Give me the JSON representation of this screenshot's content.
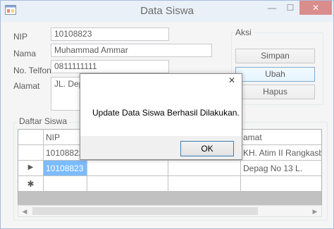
{
  "window": {
    "title": "Data Siswa",
    "minimize_glyph": "—",
    "maximize_glyph": "☐",
    "close_glyph": "✕"
  },
  "form": {
    "nip_label": "NIP",
    "nip_value": "10108823",
    "nama_label": "Nama",
    "nama_value": "Muhammad Ammar",
    "telfon_label": "No. Telfon",
    "telfon_value": "0811111111",
    "alamat_label": "Alamat",
    "alamat_value": "JL. Depa"
  },
  "aksi": {
    "group_title": "Aksi",
    "simpan_label": "Simpan",
    "ubah_label": "Ubah",
    "hapus_label": "Hapus"
  },
  "daftar": {
    "group_title": "Daftar Siswa",
    "columns": [
      "NIP",
      "",
      "",
      "amat"
    ],
    "rows": [
      {
        "indicator": "",
        "nip": "10108822",
        "alamat": "KH. Atim II Rangkasbitung"
      },
      {
        "indicator": "▶",
        "nip": "10108823",
        "alamat": "Depag No 13 L."
      },
      {
        "indicator": "✱",
        "nip": "",
        "alamat": ""
      }
    ],
    "scroll_left_glyph": "◀",
    "scroll_right_glyph": "▶"
  },
  "dialog": {
    "close_glyph": "✕",
    "message": "Update Data Siswa Berhasil Dilakukan.",
    "ok_label": "OK"
  },
  "colors": {
    "selection": "#3399ff",
    "titlebar": "#dfe8f4",
    "close_button": "#c75050"
  },
  "icons": {
    "app": "window-app-icon",
    "row_current": "row-pointer-icon",
    "row_new": "new-row-icon"
  }
}
